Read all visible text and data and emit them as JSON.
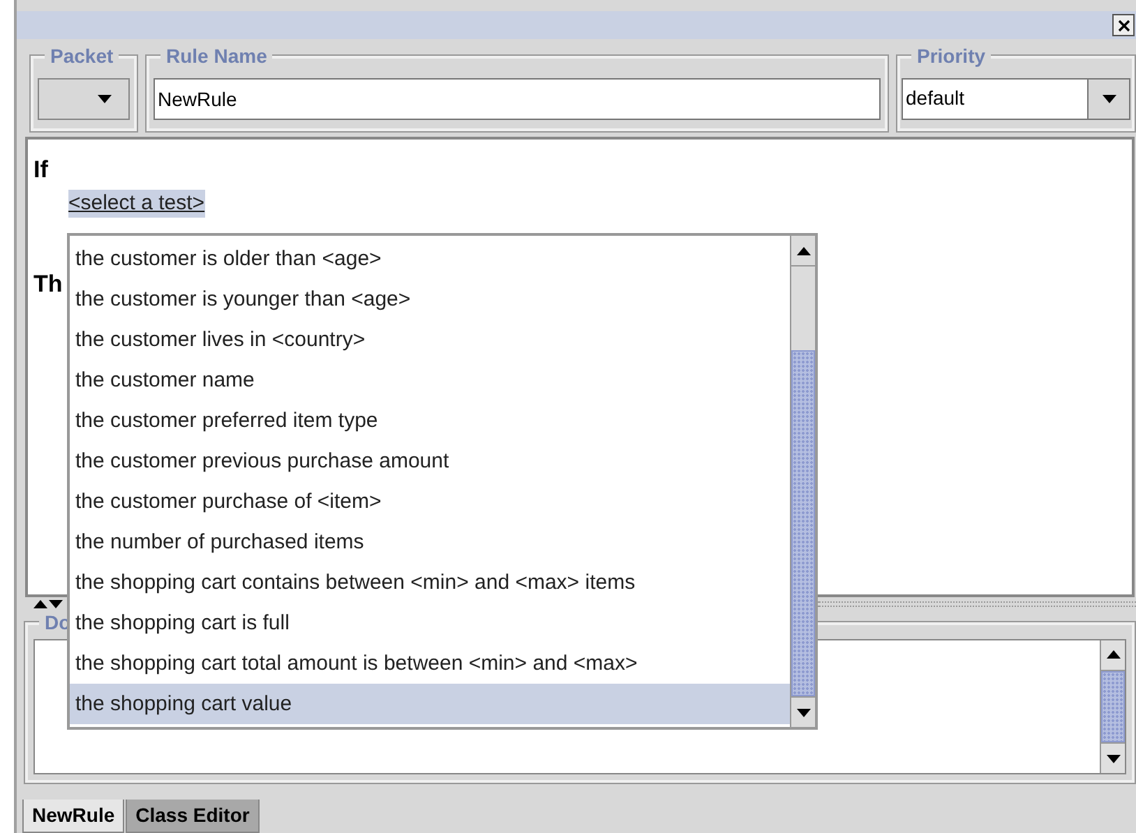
{
  "fields": {
    "packet": {
      "label": "Packet"
    },
    "rule_name": {
      "label": "Rule Name",
      "value": "NewRule"
    },
    "priority": {
      "label": "Priority",
      "value": "default"
    }
  },
  "condition": {
    "heading": "If",
    "test_link": "<select a test>",
    "then_heading": "Th"
  },
  "test_list": [
    {
      "label": "the customer is older than <age>",
      "selected": false
    },
    {
      "label": "the customer is younger than <age>",
      "selected": false
    },
    {
      "label": "the customer lives in <country>",
      "selected": false
    },
    {
      "label": "the customer name",
      "selected": false
    },
    {
      "label": "the customer preferred item type",
      "selected": false
    },
    {
      "label": "the customer previous purchase amount",
      "selected": false
    },
    {
      "label": "the customer purchase of <item>",
      "selected": false
    },
    {
      "label": "the number of purchased items",
      "selected": false
    },
    {
      "label": "the shopping cart contains between <min> and <max> items",
      "selected": false
    },
    {
      "label": "the shopping cart is full",
      "selected": false
    },
    {
      "label": "the shopping cart total amount is between <min> and <max>",
      "selected": false
    },
    {
      "label": "the shopping cart value",
      "selected": true
    }
  ],
  "documentation": {
    "label": "Do"
  },
  "tabs": [
    {
      "label": "NewRule",
      "selected": true
    },
    {
      "label": "Class Editor",
      "selected": false
    }
  ]
}
